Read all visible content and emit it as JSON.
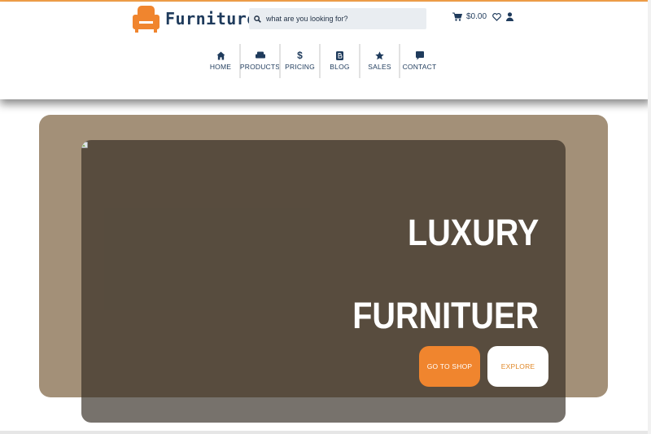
{
  "brand": {
    "name": "Furniture",
    "accent": "#f0852e",
    "primary": "#1f3b5c"
  },
  "search": {
    "placeholder": "what are you looking for?"
  },
  "cart": {
    "amount": "$0.00"
  },
  "nav": {
    "items": [
      {
        "label": "HOME",
        "icon": "home-icon"
      },
      {
        "label": "PRODUCTS",
        "icon": "sofa-icon"
      },
      {
        "label": "PRICING",
        "icon": "dollar-icon",
        "glyph": "$"
      },
      {
        "label": "BLOG",
        "icon": "blog-icon"
      },
      {
        "label": "SALES",
        "icon": "star-icon"
      },
      {
        "label": "CONTACT",
        "icon": "chat-icon"
      }
    ]
  },
  "hero": {
    "line1": "LUXURY",
    "line2": "FURNITUER",
    "shop_button": "GO TO SHOP",
    "explore_button": "EXPLORE"
  }
}
